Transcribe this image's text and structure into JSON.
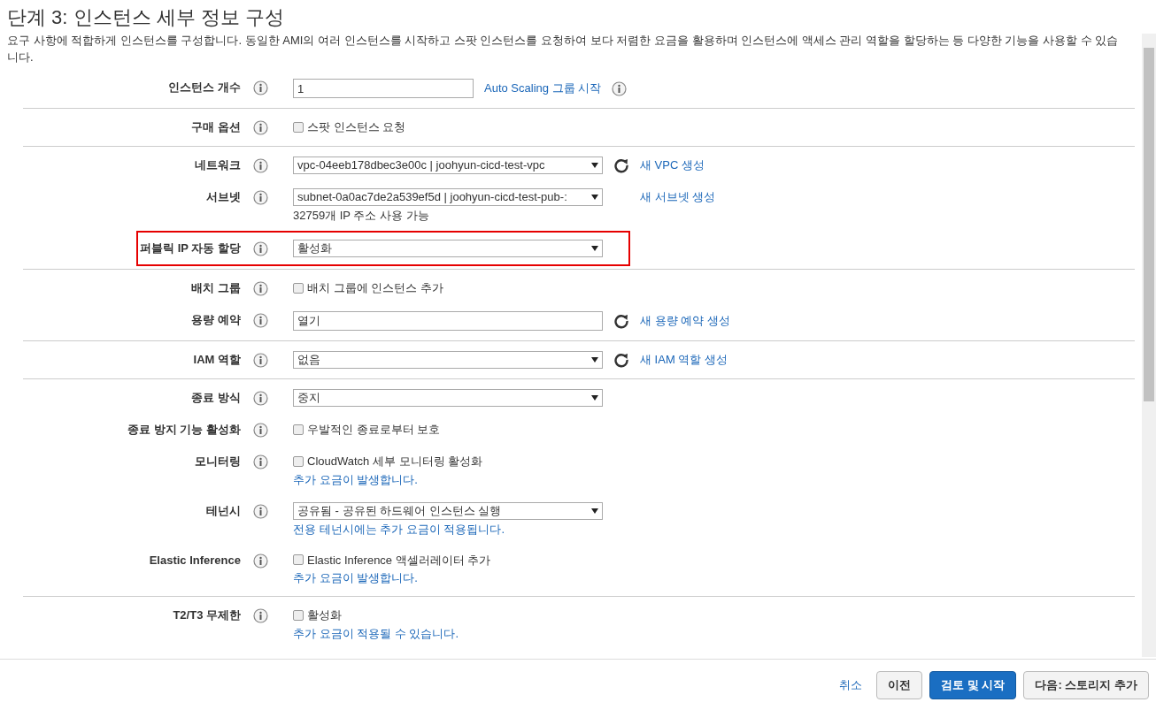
{
  "title": "단계 3: 인스턴스 세부 정보 구성",
  "description": "요구 사항에 적합하게 인스턴스를 구성합니다. 동일한 AMI의 여러 인스턴스를 시작하고 스팟 인스턴스를 요청하여 보다 저렴한 요금을 활용하며 인스턴스에 액세스 관리 역할을 할당하는 등 다양한 기능을 사용할 수 있습니다.",
  "sections": [
    {
      "rows": [
        {
          "label": "인스턴스 개수",
          "kind": "input",
          "value": "1",
          "link": "Auto Scaling 그룹 시작",
          "link_info": true
        }
      ]
    },
    {
      "rows": [
        {
          "label": "구매 옵션",
          "kind": "checkbox",
          "value": "스팟 인스턴스 요청",
          "checked": false
        }
      ]
    },
    {
      "rows": [
        {
          "label": "네트워크",
          "kind": "select",
          "value": "vpc-04eeb178dbec3e00c | joohyun-cicd-test-vpc",
          "refresh": true,
          "link": "새 VPC 생성"
        },
        {
          "label": "서브넷",
          "kind": "select",
          "value": "subnet-0a0ac7de2a539ef5d | joohyun-cicd-test-pub-:",
          "link": "새 서브넷 생성",
          "note": "32759개 IP 주소 사용 가능"
        },
        {
          "label": "퍼블릭 IP 자동 할당",
          "kind": "select",
          "value": "활성화",
          "highlighted": true
        }
      ]
    },
    {
      "rows": [
        {
          "label": "배치 그룹",
          "kind": "checkbox",
          "value": "배치 그룹에 인스턴스 추가",
          "checked": false
        },
        {
          "label": "용량 예약",
          "kind": "input",
          "value": "열기",
          "refresh": true,
          "link": "새 용량 예약 생성"
        }
      ]
    },
    {
      "rows": [
        {
          "label": "IAM 역할",
          "kind": "select",
          "value": "없음",
          "refresh": true,
          "link": "새 IAM 역할 생성"
        }
      ]
    },
    {
      "rows": [
        {
          "label": "종료 방식",
          "kind": "select",
          "value": "중지"
        },
        {
          "label": "종료 방지 기능 활성화",
          "kind": "checkbox",
          "value": "우발적인 종료로부터 보호",
          "checked": false
        },
        {
          "label": "모니터링",
          "kind": "checkbox",
          "value": "CloudWatch 세부 모니터링 활성화",
          "checked": false,
          "note_link": "추가 요금이 발생합니다."
        },
        {
          "label": "테넌시",
          "kind": "select",
          "value": "공유됨 - 공유된 하드웨어 인스턴스 실행",
          "note_link": "전용 테넌시에는 추가 요금이 적용됩니다."
        },
        {
          "label": "Elastic Inference",
          "kind": "checkbox",
          "value": "Elastic Inference 액셀러레이터 추가",
          "checked": false,
          "note_link": "추가 요금이 발생합니다."
        }
      ]
    },
    {
      "rows": [
        {
          "label": "T2/T3 무제한",
          "kind": "checkbox",
          "value": "활성화",
          "checked": false,
          "note_link": "추가 요금이 적용될 수 있습니다."
        }
      ]
    }
  ],
  "footer": [
    {
      "label": "취소",
      "kind": "link"
    },
    {
      "label": "이전",
      "kind": "secondary"
    },
    {
      "label": "검토 및 시작",
      "kind": "primary"
    },
    {
      "label": "다음: 스토리지 추가",
      "kind": "secondary"
    }
  ]
}
